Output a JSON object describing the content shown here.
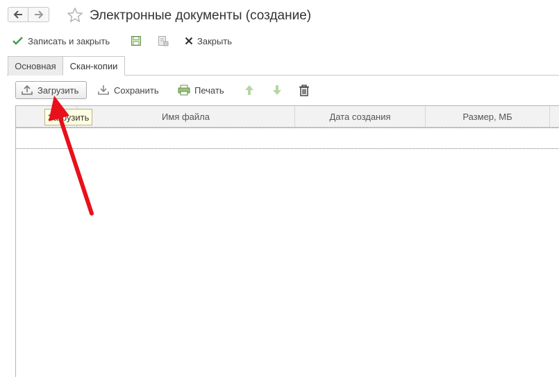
{
  "window": {
    "title": "Электронные документы (создание)"
  },
  "command_bar": {
    "save_close_label": "Записать и закрыть",
    "close_label": "Закрыть"
  },
  "tabs": [
    {
      "label": "Основная",
      "active": false
    },
    {
      "label": "Скан-копии",
      "active": true
    }
  ],
  "toolbar": {
    "upload_label": "Загрузить",
    "save_label": "Сохранить",
    "print_label": "Печать"
  },
  "tooltip": {
    "text": "Загрузить"
  },
  "table": {
    "columns": [
      "",
      "Имя файла",
      "Дата создания",
      "Размер, МБ"
    ],
    "rows": []
  },
  "colors": {
    "annotation_arrow": "#e8101a",
    "checkmark_green": "#3aa043",
    "tooltip_bg": "#ffffe1"
  }
}
